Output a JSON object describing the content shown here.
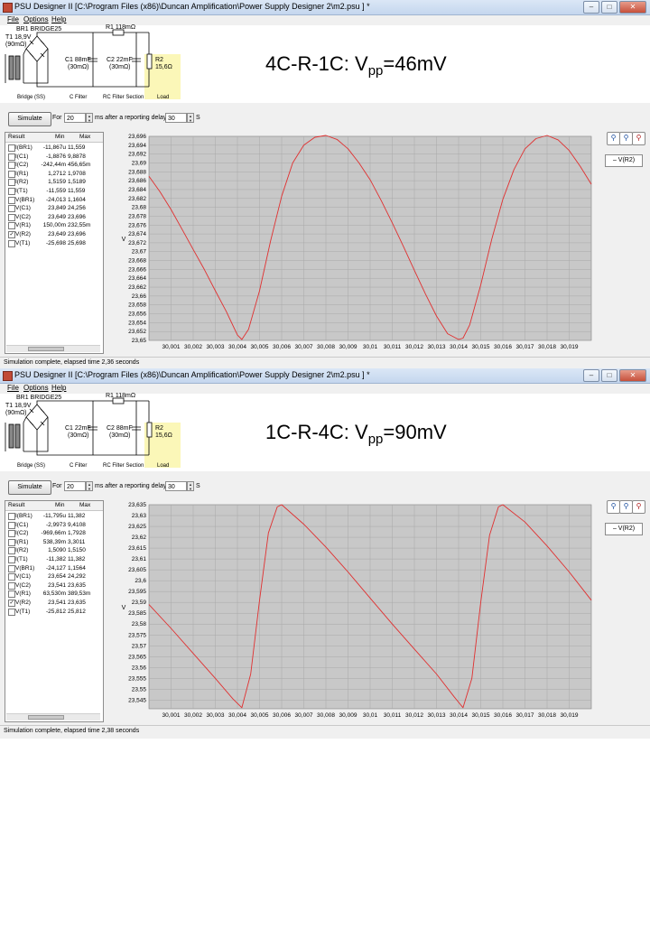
{
  "windows": [
    {
      "title": "PSU Designer II  [C:\\Program Files (x86)\\Duncan Amplification\\Power Supply Designer 2\\m2.psu ] *",
      "menu": [
        "File",
        "Options",
        "Help"
      ],
      "circuit": {
        "bridge_name": "BR1 BRIDGE25",
        "t1_line1": "T1 18,9V",
        "t1_line2": "(90mΩ)",
        "r1": "R1 118mΩ",
        "c1_line1": "C1 88mF",
        "c1_line2": "(30mΩ)",
        "c2_line1": "C2 22mF",
        "c2_line2": "(30mΩ)",
        "r2_line1": "R2",
        "r2_line2": "15,6Ω",
        "sections": [
          "Bridge (SS)",
          "C Filter",
          "RC Filter Section",
          "Load"
        ]
      },
      "annotation": {
        "main": "4C-R-1C: V",
        "sub": "pp",
        "tail": "=46mV"
      },
      "toolbar": {
        "simulate": "Simulate",
        "for": "For",
        "duration": "20",
        "ms_label": "ms  after a reporting delay of",
        "delay": "30",
        "s_label": "S"
      },
      "results": {
        "headers": [
          "Result",
          "Min",
          "Max"
        ],
        "rows": [
          {
            "checked": false,
            "name": "I(BR1)",
            "min": "-11,867u",
            "max": "11,559"
          },
          {
            "checked": false,
            "name": "I(C1)",
            "min": "-1,8876",
            "max": "9,8878"
          },
          {
            "checked": false,
            "name": "I(C2)",
            "min": "-242,44m",
            "max": "456,65m"
          },
          {
            "checked": false,
            "name": "I(R1)",
            "min": "1,2712",
            "max": "1,9708"
          },
          {
            "checked": false,
            "name": "I(R2)",
            "min": "1,5159",
            "max": "1,5189"
          },
          {
            "checked": false,
            "name": "I(T1)",
            "min": "-11,559",
            "max": "11,559"
          },
          {
            "checked": false,
            "name": "V(BR1)",
            "min": "-24,013",
            "max": "1,1604"
          },
          {
            "checked": false,
            "name": "V(C1)",
            "min": "23,849",
            "max": "24,256"
          },
          {
            "checked": false,
            "name": "V(C2)",
            "min": "23,649",
            "max": "23,696"
          },
          {
            "checked": false,
            "name": "V(R1)",
            "min": "150,00m",
            "max": "232,55m"
          },
          {
            "checked": true,
            "name": "V(R2)",
            "min": "23,649",
            "max": "23,696"
          },
          {
            "checked": false,
            "name": "V(T1)",
            "min": "-25,698",
            "max": "25,698"
          }
        ]
      },
      "legend": "V(R2)",
      "status": "Simulation complete, elapsed time 2,36 seconds",
      "chart_data": {
        "type": "line",
        "ylabel": "V",
        "xlim": [
          30.0,
          30.02
        ],
        "ylim": [
          23.65,
          23.696
        ],
        "yticks": [
          "23,65",
          "23,652",
          "23,654",
          "23,656",
          "23,658",
          "23,66",
          "23,662",
          "23,664",
          "23,666",
          "23,668",
          "23,67",
          "23,672",
          "23,674",
          "23,676",
          "23,678",
          "23,68",
          "23,682",
          "23,684",
          "23,686",
          "23,688",
          "23,69",
          "23,692",
          "23,694",
          "23,696"
        ],
        "xticks": [
          "30,001",
          "30,002",
          "30,003",
          "30,004",
          "30,005",
          "30,006",
          "30,007",
          "30,008",
          "30,009",
          "30,01",
          "30,011",
          "30,012",
          "30,013",
          "30,014",
          "30,015",
          "30,016",
          "30,017",
          "30,018",
          "30,019"
        ],
        "grid": true,
        "series": [
          {
            "name": "V(R2)",
            "color": "#e03030",
            "x": [
              30.0,
              30.0005,
              30.001,
              30.0015,
              30.002,
              30.0025,
              30.003,
              30.0035,
              30.004,
              30.0042,
              30.0045,
              30.005,
              30.0055,
              30.006,
              30.0065,
              30.007,
              30.0075,
              30.008,
              30.0085,
              30.009,
              30.0095,
              30.01,
              30.0105,
              30.011,
              30.0115,
              30.012,
              30.0125,
              30.013,
              30.0135,
              30.014,
              30.0142,
              30.0145,
              30.015,
              30.0155,
              30.016,
              30.0165,
              30.017,
              30.0175,
              30.018,
              30.0185,
              30.019,
              30.0195,
              30.02
            ],
            "y": [
              23.687,
              23.6835,
              23.6795,
              23.675,
              23.6705,
              23.666,
              23.6612,
              23.6565,
              23.6512,
              23.6502,
              23.6525,
              23.6612,
              23.6725,
              23.6825,
              23.69,
              23.694,
              23.6958,
              23.6962,
              23.6953,
              23.6932,
              23.69,
              23.6862,
              23.6815,
              23.6765,
              23.6712,
              23.6658,
              23.6605,
              23.6555,
              23.6515,
              23.6502,
              23.6505,
              23.6535,
              23.6625,
              23.6728,
              23.6818,
              23.6885,
              23.6932,
              23.6955,
              23.6962,
              23.6952,
              23.6928,
              23.6892,
              23.6852
            ]
          }
        ]
      }
    },
    {
      "title": "PSU Designer II  [C:\\Program Files (x86)\\Duncan Amplification\\Power Supply Designer 2\\m2.psu ] *",
      "menu": [
        "File",
        "Options",
        "Help"
      ],
      "circuit": {
        "bridge_name": "BR1 BRIDGE25",
        "t1_line1": "T1 18,9V",
        "t1_line2": "(90mΩ)",
        "r1": "R1 118mΩ",
        "c1_line1": "C1 22mF",
        "c1_line2": "(30mΩ)",
        "c2_line1": "C2 88mF",
        "c2_line2": "(30mΩ)",
        "r2_line1": "R2",
        "r2_line2": "15,6Ω",
        "sections": [
          "Bridge (SS)",
          "C Filter",
          "RC Filter Section",
          "Load"
        ]
      },
      "annotation": {
        "main": "1C-R-4C: V",
        "sub": "pp",
        "tail": "=90mV"
      },
      "toolbar": {
        "simulate": "Simulate",
        "for": "For",
        "duration": "20",
        "ms_label": "ms  after a reporting delay of",
        "delay": "30",
        "s_label": "S"
      },
      "results": {
        "headers": [
          "Result",
          "Min",
          "Max"
        ],
        "rows": [
          {
            "checked": false,
            "name": "I(BR1)",
            "min": "-11,795u",
            "max": "11,382"
          },
          {
            "checked": false,
            "name": "I(C1)",
            "min": "-2,9973",
            "max": "9,4108"
          },
          {
            "checked": false,
            "name": "I(C2)",
            "min": "-969,66m",
            "max": "1,7928"
          },
          {
            "checked": false,
            "name": "I(R1)",
            "min": "538,39m",
            "max": "3,3011"
          },
          {
            "checked": false,
            "name": "I(R2)",
            "min": "1,5090",
            "max": "1,5150"
          },
          {
            "checked": false,
            "name": "I(T1)",
            "min": "-11,382",
            "max": "11,382"
          },
          {
            "checked": false,
            "name": "V(BR1)",
            "min": "-24,127",
            "max": "1,1564"
          },
          {
            "checked": false,
            "name": "V(C1)",
            "min": "23,654",
            "max": "24,292"
          },
          {
            "checked": false,
            "name": "V(C2)",
            "min": "23,541",
            "max": "23,635"
          },
          {
            "checked": false,
            "name": "V(R1)",
            "min": "63,530m",
            "max": "389,53m"
          },
          {
            "checked": true,
            "name": "V(R2)",
            "min": "23,541",
            "max": "23,635"
          },
          {
            "checked": false,
            "name": "V(T1)",
            "min": "-25,812",
            "max": "25,812"
          }
        ]
      },
      "legend": "V(R2)",
      "status": "Simulation complete, elapsed time 2,38 seconds",
      "chart_data": {
        "type": "line",
        "ylabel": "V",
        "xlim": [
          30.0,
          30.02
        ],
        "ylim": [
          23.541,
          23.635
        ],
        "yticks": [
          "23,545",
          "23,55",
          "23,555",
          "23,56",
          "23,565",
          "23,57",
          "23,575",
          "23,58",
          "23,585",
          "23,59",
          "23,595",
          "23,6",
          "23,605",
          "23,61",
          "23,615",
          "23,62",
          "23,625",
          "23,63",
          "23,635"
        ],
        "xticks": [
          "30,001",
          "30,002",
          "30,003",
          "30,004",
          "30,005",
          "30,006",
          "30,007",
          "30,008",
          "30,009",
          "30,01",
          "30,011",
          "30,012",
          "30,013",
          "30,014",
          "30,015",
          "30,016",
          "30,017",
          "30,018",
          "30,019"
        ],
        "grid": true,
        "series": [
          {
            "name": "V(R2)",
            "color": "#e03030",
            "x": [
              30.0,
              30.001,
              30.002,
              30.003,
              30.0038,
              30.0042,
              30.0046,
              30.005,
              30.0054,
              30.0058,
              30.006,
              30.007,
              30.008,
              30.009,
              30.01,
              30.011,
              30.012,
              30.013,
              30.0138,
              30.0142,
              30.0146,
              30.015,
              30.0154,
              30.0158,
              30.016,
              30.017,
              30.018,
              30.019,
              30.02
            ],
            "y": [
              23.589,
              23.578,
              23.5665,
              23.555,
              23.5455,
              23.5415,
              23.557,
              23.591,
              23.622,
              23.634,
              23.635,
              23.626,
              23.6155,
              23.604,
              23.592,
              23.58,
              23.5685,
              23.557,
              23.5465,
              23.5415,
              23.555,
              23.59,
              23.621,
              23.634,
              23.635,
              23.627,
              23.616,
              23.604,
              23.591
            ]
          }
        ]
      }
    }
  ]
}
